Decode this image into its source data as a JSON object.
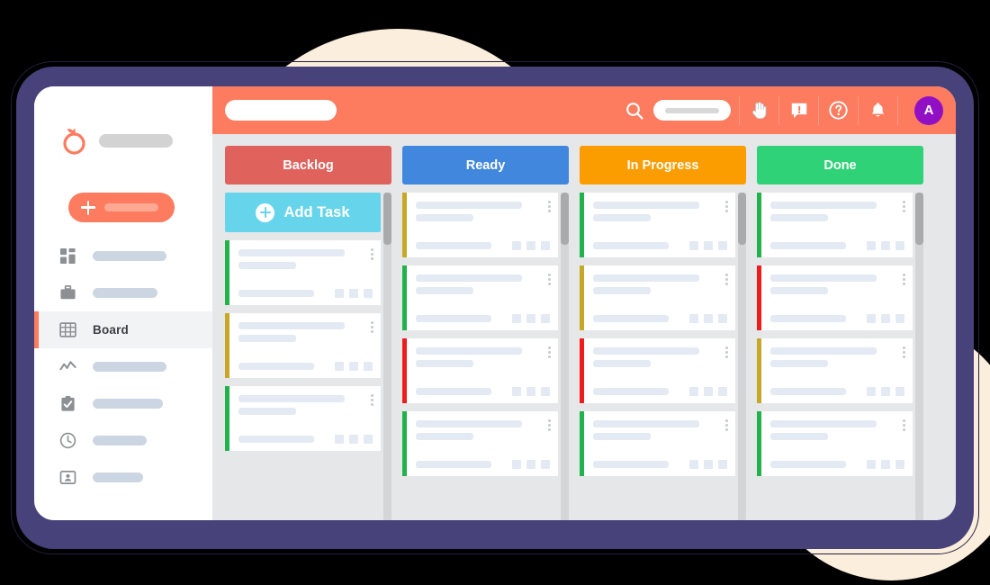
{
  "app": {
    "window_title_placeholder": "",
    "brand_logo_icon": "tomato-logo-icon",
    "menu_icon": "hamburger-menu-icon"
  },
  "colors": {
    "background": "#000000",
    "frame": "#474279",
    "frame_outline": "#23203a",
    "window": "#ffffff",
    "canvas": "#e6e7e9",
    "accent_coral": "#fd7b5e",
    "decor_cream": "#fbeedd",
    "avatar_purple": "#9210c4",
    "add_task_cyan": "#66d4ea",
    "placeholder_blue": "#e4eaf3",
    "placeholder_gray": "#ccd6e3",
    "priority_green": "#22b24c",
    "priority_gold": "#c9a726",
    "priority_red": "#f01c1c"
  },
  "sidebar": {
    "add_button": {
      "icon": "plus-icon",
      "label": ""
    },
    "items": [
      {
        "icon": "dashboard-icon",
        "label": "",
        "active": false,
        "placeholder_width": 82
      },
      {
        "icon": "briefcase-icon",
        "label": "",
        "active": false,
        "placeholder_width": 72
      },
      {
        "icon": "grid-table-icon",
        "label": "Board",
        "active": true,
        "placeholder_width": 0
      },
      {
        "icon": "analytics-line-chart-icon",
        "label": "",
        "active": false,
        "placeholder_width": 82
      },
      {
        "icon": "clipboard-check-icon",
        "label": "",
        "active": false,
        "placeholder_width": 78
      },
      {
        "icon": "clock-icon",
        "label": "",
        "active": false,
        "placeholder_width": 60
      },
      {
        "icon": "id-badge-icon",
        "label": "",
        "active": false,
        "placeholder_width": 56
      }
    ]
  },
  "topbar": {
    "title_pill": "",
    "search_icon": "search-icon",
    "search": {
      "value": "",
      "placeholder": ""
    },
    "actions": [
      {
        "icon": "hand-pointer-icon",
        "label": ""
      },
      {
        "icon": "feedback-alert-icon",
        "label": ""
      },
      {
        "icon": "help-question-icon",
        "label": ""
      },
      {
        "icon": "notification-bell-icon",
        "label": ""
      }
    ],
    "avatar": {
      "initial": "A"
    }
  },
  "board": {
    "columns": [
      {
        "title": "Backlog",
        "header_color": "#e0625d",
        "has_add_task": true,
        "add_task_label": "Add Task",
        "scroll_thumb_top": 0,
        "scroll_thumb_height": 58,
        "cards": [
          {
            "priority": "#22b24c"
          },
          {
            "priority": "#c9a726"
          },
          {
            "priority": "#22b24c"
          }
        ]
      },
      {
        "title": "Ready",
        "header_color": "#4087dd",
        "has_add_task": false,
        "add_task_label": "",
        "scroll_thumb_top": 0,
        "scroll_thumb_height": 58,
        "cards": [
          {
            "priority": "#c9a726"
          },
          {
            "priority": "#22b24c"
          },
          {
            "priority": "#f01c1c"
          },
          {
            "priority": "#22b24c"
          }
        ]
      },
      {
        "title": "In Progress",
        "header_color": "#fb9d00",
        "has_add_task": false,
        "add_task_label": "",
        "scroll_thumb_top": 0,
        "scroll_thumb_height": 58,
        "cards": [
          {
            "priority": "#22b24c"
          },
          {
            "priority": "#c9a726"
          },
          {
            "priority": "#f01c1c"
          },
          {
            "priority": "#22b24c"
          }
        ]
      },
      {
        "title": "Done",
        "header_color": "#30d277",
        "has_add_task": false,
        "add_task_label": "",
        "scroll_thumb_top": 0,
        "scroll_thumb_height": 58,
        "cards": [
          {
            "priority": "#22b24c"
          },
          {
            "priority": "#f01c1c"
          },
          {
            "priority": "#c9a726"
          },
          {
            "priority": "#22b24c"
          }
        ]
      }
    ]
  }
}
